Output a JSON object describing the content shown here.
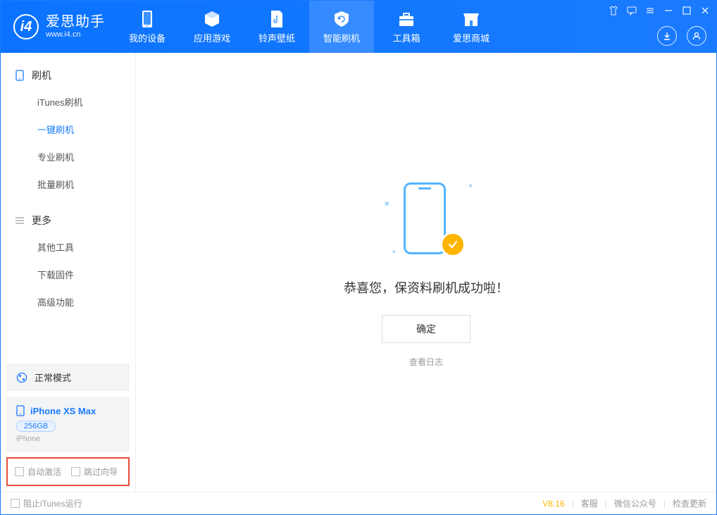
{
  "app": {
    "title": "爱思助手",
    "url": "www.i4.cn"
  },
  "topnav": {
    "items": [
      {
        "label": "我的设备"
      },
      {
        "label": "应用游戏"
      },
      {
        "label": "铃声壁纸"
      },
      {
        "label": "智能刷机"
      },
      {
        "label": "工具箱"
      },
      {
        "label": "爱思商城"
      }
    ],
    "active_index": 3
  },
  "sidebar": {
    "section1": {
      "title": "刷机",
      "items": [
        {
          "label": "iTunes刷机"
        },
        {
          "label": "一键刷机"
        },
        {
          "label": "专业刷机"
        },
        {
          "label": "批量刷机"
        }
      ],
      "active_index": 1
    },
    "section2": {
      "title": "更多",
      "items": [
        {
          "label": "其他工具"
        },
        {
          "label": "下载固件"
        },
        {
          "label": "高级功能"
        }
      ]
    },
    "status": {
      "label": "正常模式"
    },
    "device": {
      "name": "iPhone XS Max",
      "storage": "256GB",
      "type": "iPhone"
    },
    "checks": {
      "auto_activate": "自动激活",
      "skip_guide": "跳过向导"
    }
  },
  "main": {
    "success_message": "恭喜您，保资料刷机成功啦！",
    "ok_label": "确定",
    "view_log_label": "查看日志"
  },
  "statusbar": {
    "block_itunes": "阻止iTunes运行",
    "version": "V8.16",
    "links": {
      "support": "客服",
      "wechat": "微信公众号",
      "update": "检查更新"
    }
  }
}
